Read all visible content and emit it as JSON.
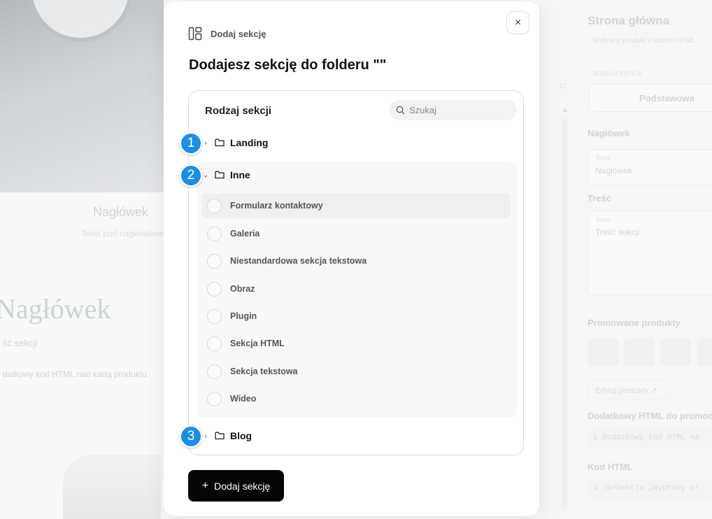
{
  "background": {
    "left_heading_small": "Nagłówek",
    "left_subtext": "Tekst pod nagłówkiem",
    "big_heading": "Nagłówek",
    "small_text": "ść sekcji",
    "html_text": "datkowy kod HTML nad kartą produktu",
    "gutter_number": "17",
    "right_panel": {
      "title": "Strona główna",
      "subtitle": "Wybrany produkt z kodem HTML",
      "edit_type_label": "RODZAJ EDYCJI",
      "edit_type_value": "Podstawowa",
      "heading_section": "Nagłówek",
      "heading_field_label": "Treść",
      "heading_field_value": "Nagłówek",
      "content_section": "Treść",
      "content_field_label": "Treść",
      "content_field_value": "Treść sekcji",
      "promoted_section": "Promowane produkty",
      "edit_products_button": "Edytuj produkty ↗",
      "extra_html_section": "Dodatkowy HTML do promocj",
      "extra_html_code": "1   Dodatkowy kod HTML na",
      "html_code_section": "Kod HTML",
      "html_code": "1   <b>Sekcja „Wybrany pr"
    }
  },
  "modal": {
    "header_label": "Dodaj sekcję",
    "title": "Dodajesz sekcję do folderu \"\"",
    "close_icon": "×",
    "panel_title": "Rodzaj sekcji",
    "search_placeholder": "Szukaj",
    "folders": [
      {
        "name": "Landing",
        "expanded": false,
        "badge": "1"
      },
      {
        "name": "Inne",
        "expanded": true,
        "badge": "2"
      },
      {
        "name": "Blog",
        "expanded": false,
        "badge": "3"
      }
    ],
    "inne_items": [
      "Formularz kontaktowy",
      "Galeria",
      "Niestandardowa sekcja tekstowa",
      "Obraz",
      "Plugin",
      "Sekcja HTML",
      "Sekcja tekstowa",
      "Wideo"
    ],
    "add_button": {
      "icon": "+",
      "label": "Dodaj sekcję"
    }
  },
  "colors": {
    "accent": "#1d8fe0",
    "primary_button": "#050505"
  }
}
